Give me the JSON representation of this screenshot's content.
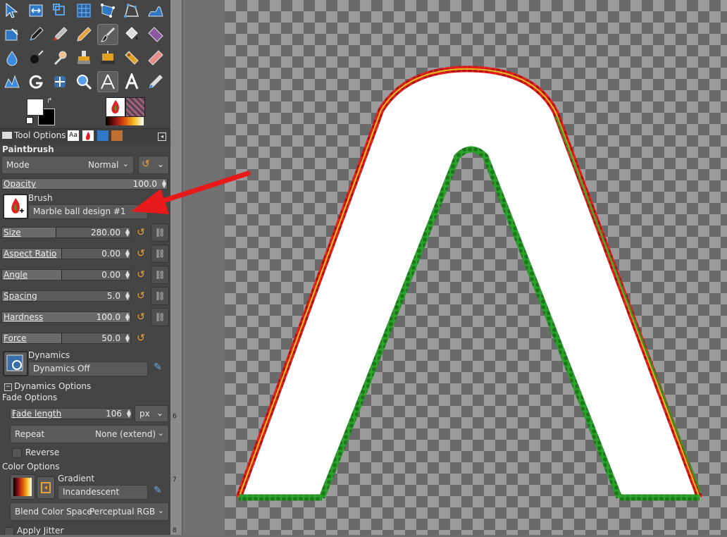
{
  "tool_options": {
    "tab_label": "Tool Options",
    "tool_name": "Paintbrush",
    "mode_label": "Mode",
    "mode_value": "Normal",
    "opacity_label": "Opacity",
    "opacity_value": "100.0",
    "brush_label": "Brush",
    "brush_value": "Marble ball design #1",
    "sliders": [
      {
        "name": "Size",
        "value": "280.00",
        "fill": 0.42
      },
      {
        "name": "Aspect Ratio",
        "value": "0.00",
        "fill": 0.46
      },
      {
        "name": "Angle",
        "value": "0.00",
        "fill": 0.46
      },
      {
        "name": "Spacing",
        "value": "5.0",
        "fill": 0.05
      },
      {
        "name": "Hardness",
        "value": "100.0",
        "fill": 1.0
      },
      {
        "name": "Force",
        "value": "50.0",
        "fill": 0.46
      }
    ],
    "dynamics_label": "Dynamics",
    "dynamics_value": "Dynamics Off",
    "dynamics_options_label": "Dynamics Options",
    "fade_options_label": "Fade Options",
    "fade_length_label": "Fade length",
    "fade_length_value": "106",
    "fade_unit": "px",
    "repeat_label": "Repeat",
    "repeat_value": "None (extend)",
    "reverse_label": "Reverse",
    "color_options_label": "Color Options",
    "gradient_label": "Gradient",
    "gradient_value": "Incandescent",
    "blend_color_space_label": "Blend Color Space",
    "blend_color_space_value": "Perceptual RGB",
    "apply_jitter_label": "Apply Jitter"
  },
  "ruler_labels": [
    "6",
    "7",
    "8"
  ],
  "colors": {
    "arrow": "#e8191b",
    "accent": "#f0a030"
  }
}
